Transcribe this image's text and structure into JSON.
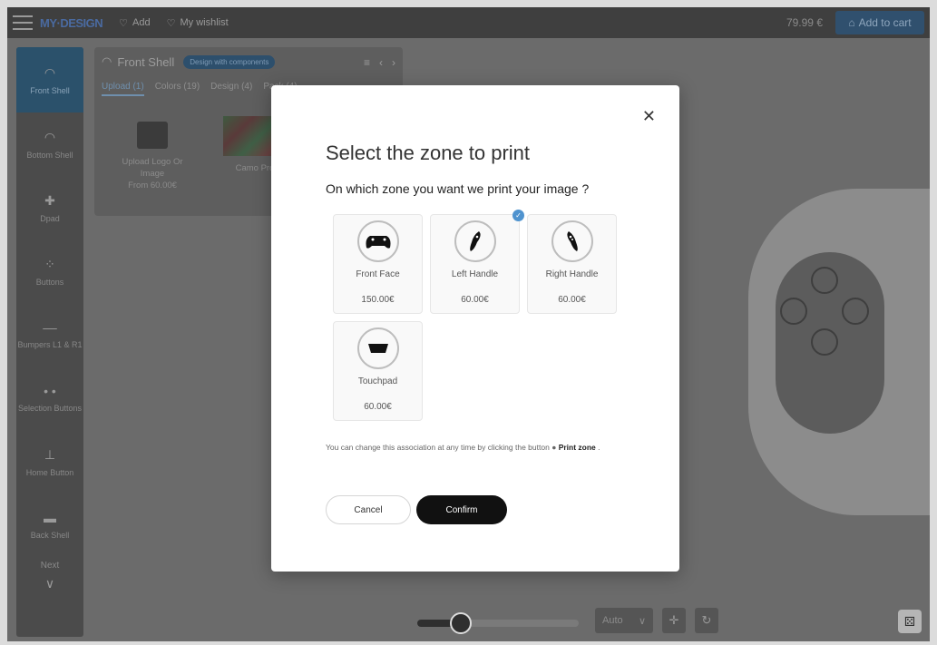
{
  "topbar": {
    "logo": "MY·DESIGN",
    "add_label": "Add",
    "wishlist_label": "My wishlist",
    "price": "79.99 €",
    "cart_label": "Add to cart"
  },
  "rail": {
    "items": [
      {
        "label": "Front Shell"
      },
      {
        "label": "Bottom Shell"
      },
      {
        "label": "Dpad"
      },
      {
        "label": "Buttons"
      },
      {
        "label": "Bumpers L1 & R1"
      },
      {
        "label": "Selection Buttons"
      },
      {
        "label": "Home Button"
      },
      {
        "label": "Back Shell"
      }
    ],
    "next_label": "Next"
  },
  "panel": {
    "title": "Front Shell",
    "badge": "Design with components",
    "tabs": [
      "Upload (1)",
      "Colors (19)",
      "Design (4)",
      "Pack (4)"
    ],
    "upload_card": {
      "line1": "Upload Logo Or",
      "line2": "Image",
      "price": "From 60.00€"
    },
    "camo_card": {
      "label": "Camo Pro"
    }
  },
  "bottom": {
    "auto_label": "Auto"
  },
  "modal": {
    "title": "Select the zone to print",
    "subtitle": "On which zone you want we print your image ?",
    "zones": [
      {
        "name": "Front Face",
        "price": "150.00€",
        "selected": false
      },
      {
        "name": "Left Handle",
        "price": "60.00€",
        "selected": true
      },
      {
        "name": "Right Handle",
        "price": "60.00€",
        "selected": false
      },
      {
        "name": "Touchpad",
        "price": "60.00€",
        "selected": false
      }
    ],
    "note_text": "You can change this association at any time by clicking the button",
    "note_bold": "Print zone",
    "cancel_label": "Cancel",
    "confirm_label": "Confirm"
  }
}
